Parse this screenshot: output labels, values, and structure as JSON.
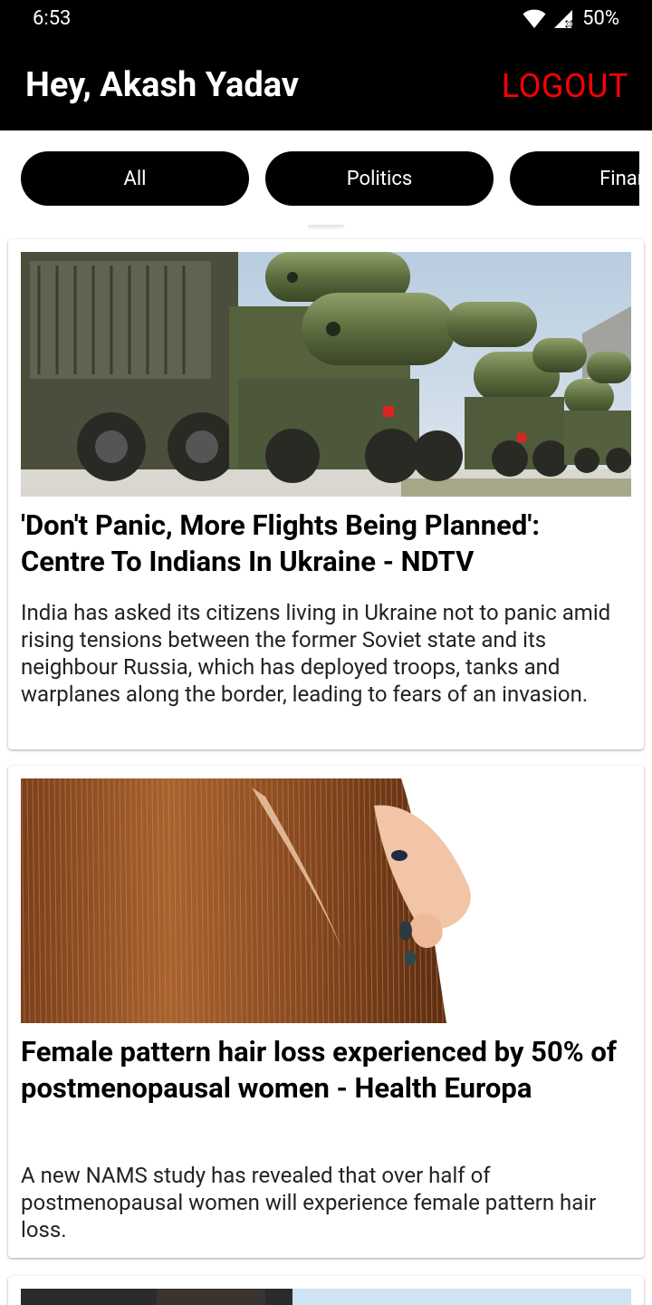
{
  "status_bar": {
    "time": "6:53",
    "battery": "50%",
    "icons": [
      "wifi-icon",
      "signal-icon"
    ]
  },
  "header": {
    "greeting": "Hey, Akash Yadav",
    "logout_label": "LOGOUT",
    "logout_color": "#ff0000"
  },
  "categories": [
    {
      "label": "All"
    },
    {
      "label": "Politics"
    },
    {
      "label": "Finan"
    }
  ],
  "articles": [
    {
      "title": "'Don't Panic, More Flights Being Planned': Centre To Indians In Ukraine - NDTV",
      "description": "India has asked its citizens living in Ukraine not to panic amid rising tensions between the former Soviet state and its neighbour Russia, which has deployed troops, tanks and warplanes along the border, leading to fears of an invasion.",
      "image_subject": "military-trucks-missile-launchers"
    },
    {
      "title": "Female pattern hair loss experienced by 50% of postmenopausal women - Health Europa",
      "description": "A new NAMS study has revealed that over half of postmenopausal women will experience female pattern hair loss.",
      "image_subject": "hair-parting-closeup"
    }
  ]
}
